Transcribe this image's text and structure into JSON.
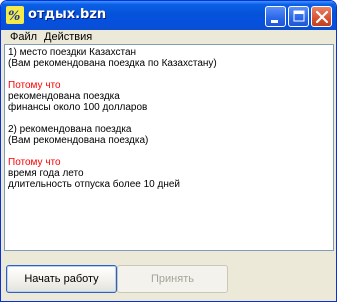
{
  "window": {
    "title": "отдых.bzn",
    "controls": {
      "minimize": "minimize",
      "maximize": "maximize",
      "close": "close"
    }
  },
  "menu": {
    "file": "Файл",
    "actions": "Действия"
  },
  "output": {
    "lines": [
      {
        "text": "1) место поездки  Казахстан",
        "color": "#000000"
      },
      {
        "text": "(Вам рекомендована поездка по Казахстану)",
        "color": "#000000"
      },
      {
        "text": "",
        "color": "#000000"
      },
      {
        "text": "Потому что",
        "color": "#ff0000"
      },
      {
        "text": "рекомендована  поездка",
        "color": "#000000"
      },
      {
        "text": "финансы  около 100 долларов",
        "color": "#000000"
      },
      {
        "text": "",
        "color": "#000000"
      },
      {
        "text": "2) рекомендована  поездка",
        "color": "#000000"
      },
      {
        "text": "(Вам рекомендована поездка)",
        "color": "#000000"
      },
      {
        "text": "",
        "color": "#000000"
      },
      {
        "text": "Потому что",
        "color": "#ff0000"
      },
      {
        "text": "время года  лето",
        "color": "#000000"
      },
      {
        "text": "длительность отпуска  более 10 дней",
        "color": "#000000"
      }
    ]
  },
  "buttons": {
    "start": "Начать работу",
    "accept": "Принять"
  }
}
